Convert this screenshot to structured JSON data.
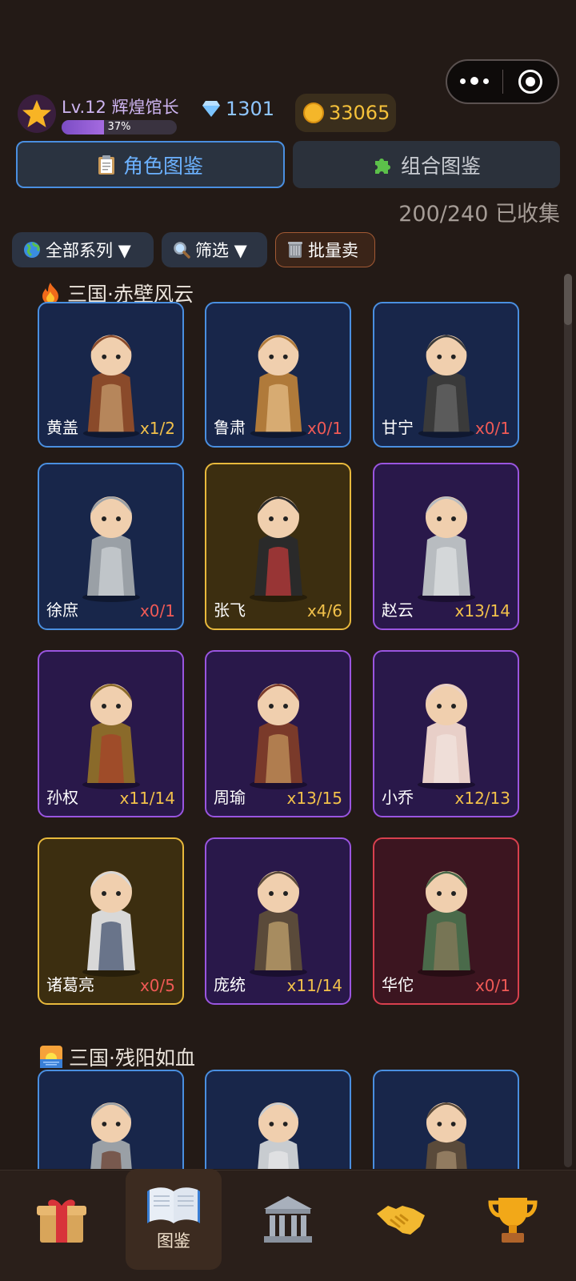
{
  "header": {
    "level_text": "Lv.12 辉煌馆长",
    "xp_percent_label": "37%",
    "xp_fraction": 0.37,
    "gems": "1301",
    "coins": "33065"
  },
  "tabs": [
    {
      "label": "角色图鉴",
      "icon": "clipboard-icon",
      "active": true
    },
    {
      "label": "组合图鉴",
      "icon": "puzzle-icon",
      "active": false
    }
  ],
  "collection_progress": "200/240 已收集",
  "filters": {
    "series": "全部系列 ▼",
    "filter": "筛选 ▼",
    "batch_sell": "批量卖"
  },
  "sections": [
    {
      "title": "三国·赤壁风云",
      "icon": "fire-icon",
      "cards": [
        {
          "name": "黄盖",
          "count": "x1/2",
          "rarity": "blue",
          "count_color": "gold"
        },
        {
          "name": "鲁肃",
          "count": "x0/1",
          "rarity": "blue",
          "count_color": "red"
        },
        {
          "name": "甘宁",
          "count": "x0/1",
          "rarity": "blue",
          "count_color": "red"
        },
        {
          "name": "徐庶",
          "count": "x0/1",
          "rarity": "blue",
          "count_color": "red"
        },
        {
          "name": "张飞",
          "count": "x4/6",
          "rarity": "gold",
          "count_color": "gold"
        },
        {
          "name": "赵云",
          "count": "x13/14",
          "rarity": "purple",
          "count_color": "gold"
        },
        {
          "name": "孙权",
          "count": "x11/14",
          "rarity": "purple",
          "count_color": "gold"
        },
        {
          "name": "周瑜",
          "count": "x13/15",
          "rarity": "purple",
          "count_color": "gold"
        },
        {
          "name": "小乔",
          "count": "x12/13",
          "rarity": "purple",
          "count_color": "gold"
        },
        {
          "name": "诸葛亮",
          "count": "x0/5",
          "rarity": "gold",
          "count_color": "red"
        },
        {
          "name": "庞统",
          "count": "x11/14",
          "rarity": "purple",
          "count_color": "gold"
        },
        {
          "name": "华佗",
          "count": "x0/1",
          "rarity": "red",
          "count_color": "red"
        }
      ]
    },
    {
      "title": "三国·残阳如血",
      "icon": "sunset-icon",
      "cards": [
        {
          "name": "",
          "count": "",
          "rarity": "blue"
        },
        {
          "name": "",
          "count": "",
          "rarity": "blue"
        },
        {
          "name": "",
          "count": "",
          "rarity": "blue"
        }
      ]
    }
  ],
  "bottom_nav": [
    {
      "icon": "gift-icon",
      "label": ""
    },
    {
      "icon": "book-icon",
      "label": "图鉴",
      "active": true
    },
    {
      "icon": "museum-icon",
      "label": ""
    },
    {
      "icon": "handshake-icon",
      "label": ""
    },
    {
      "icon": "trophy-icon",
      "label": ""
    }
  ]
}
